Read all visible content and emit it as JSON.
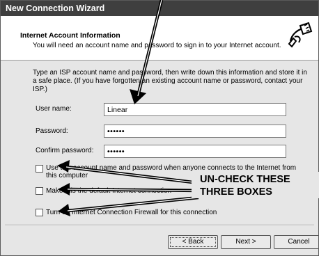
{
  "window": {
    "title": "New Connection Wizard"
  },
  "header": {
    "title": "Internet Account Information",
    "subtitle": "You will need an account name and password to sign in to your Internet account.",
    "icon": "network-plug-icon"
  },
  "description": "Type an ISP account name and password, then write down this information and store it in a safe place. (If you have forgotten an existing account name or password, contact your ISP.)",
  "form": {
    "user_name_label": "User name:",
    "user_name_value": "Linear",
    "password_label": "Password:",
    "password_value": "••••••",
    "confirm_label": "Confirm password:",
    "confirm_value": "••••••"
  },
  "checkboxes": [
    {
      "label": "Use this account name and password when anyone connects to the Internet from this computer",
      "checked": false
    },
    {
      "label": "Make this the default Internet connection",
      "checked": false
    },
    {
      "label": "Turn on Internet Connection Firewall for this connection",
      "checked": false
    }
  ],
  "buttons": {
    "back": "< Back",
    "next": "Next >",
    "cancel": "Cancel"
  },
  "annotation": {
    "line1": "UN-CHECK THESE",
    "line2": "THREE BOXES",
    "color": "#000000"
  }
}
